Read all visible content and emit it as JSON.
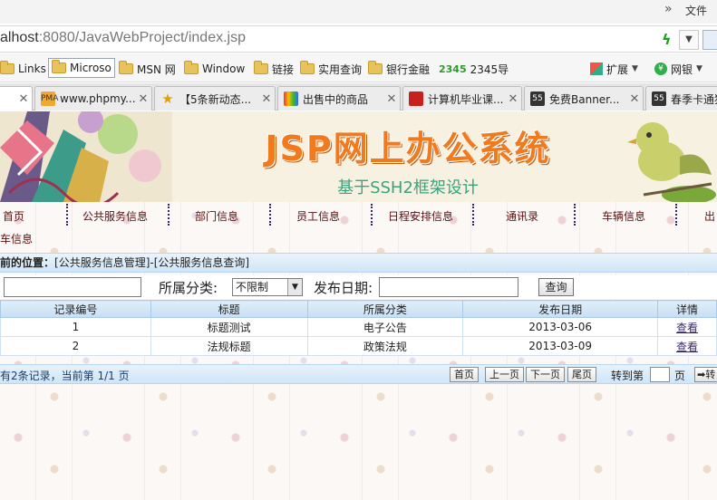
{
  "browser": {
    "top_chevron": "»",
    "file_menu": "文件",
    "url_host": "alhost",
    "url_rest": ":8080/JavaWebProject/index.jsp",
    "bookmarks": [
      "Links",
      "Microso",
      "MSN 网",
      "Window",
      "链接",
      "实用查询",
      "银行金融",
      "2345导"
    ],
    "bookmark_2345_prefix": "2345",
    "ext_label": "扩展",
    "bank_label": "网银",
    "tabs": [
      {
        "title": "",
        "active": true
      },
      {
        "title": "www.phpmy..."
      },
      {
        "title": "【5条新动态..."
      },
      {
        "title": "出售中的商品"
      },
      {
        "title": "计算机毕业课..."
      },
      {
        "title": "免费Banner..."
      },
      {
        "title": "春季卡通猪"
      }
    ],
    "tab_icon_labels": {
      "pma": "PMA",
      "f55": "55"
    }
  },
  "banner": {
    "title": "JSP网上办公系统",
    "subtitle": "基于SSH2框架设计"
  },
  "nav": {
    "items": [
      "首页",
      "公共服务信息",
      "部门信息",
      "员工信息",
      "日程安排信息",
      "通讯录",
      "车辆信息",
      "出"
    ],
    "second_row": "车信息"
  },
  "location": {
    "prefix": "前的位置：",
    "path": "[公共服务信息管理]-[公共服务信息查询]"
  },
  "search": {
    "category_label": "所属分类:",
    "category_value": "不限制",
    "date_label": "发布日期:",
    "query_button": "查询",
    "keyword_value": "",
    "date_value": ""
  },
  "table": {
    "headers": [
      "记录编号",
      "标题",
      "所属分类",
      "发布日期",
      "详情"
    ],
    "rows": [
      {
        "id": "1",
        "title": "标题测试",
        "category": "电子公告",
        "date": "2013-03-06",
        "detail": "查看"
      },
      {
        "id": "2",
        "title": "法规标题",
        "category": "政策法规",
        "date": "2013-03-09",
        "detail": "查看"
      }
    ]
  },
  "pager": {
    "info": "有2条记录，当前第 1/1 页",
    "first": "首页",
    "prev": "上一页",
    "next": "下一页",
    "last": "尾页",
    "goto_label": "转到第",
    "page_unit": "页",
    "go_button": "➡转"
  },
  "colors": {
    "banner_title": "#f07a1d",
    "banner_subtitle": "#3aa37e",
    "nav_text": "#5a1212",
    "header_bg": "#c6dff3"
  }
}
